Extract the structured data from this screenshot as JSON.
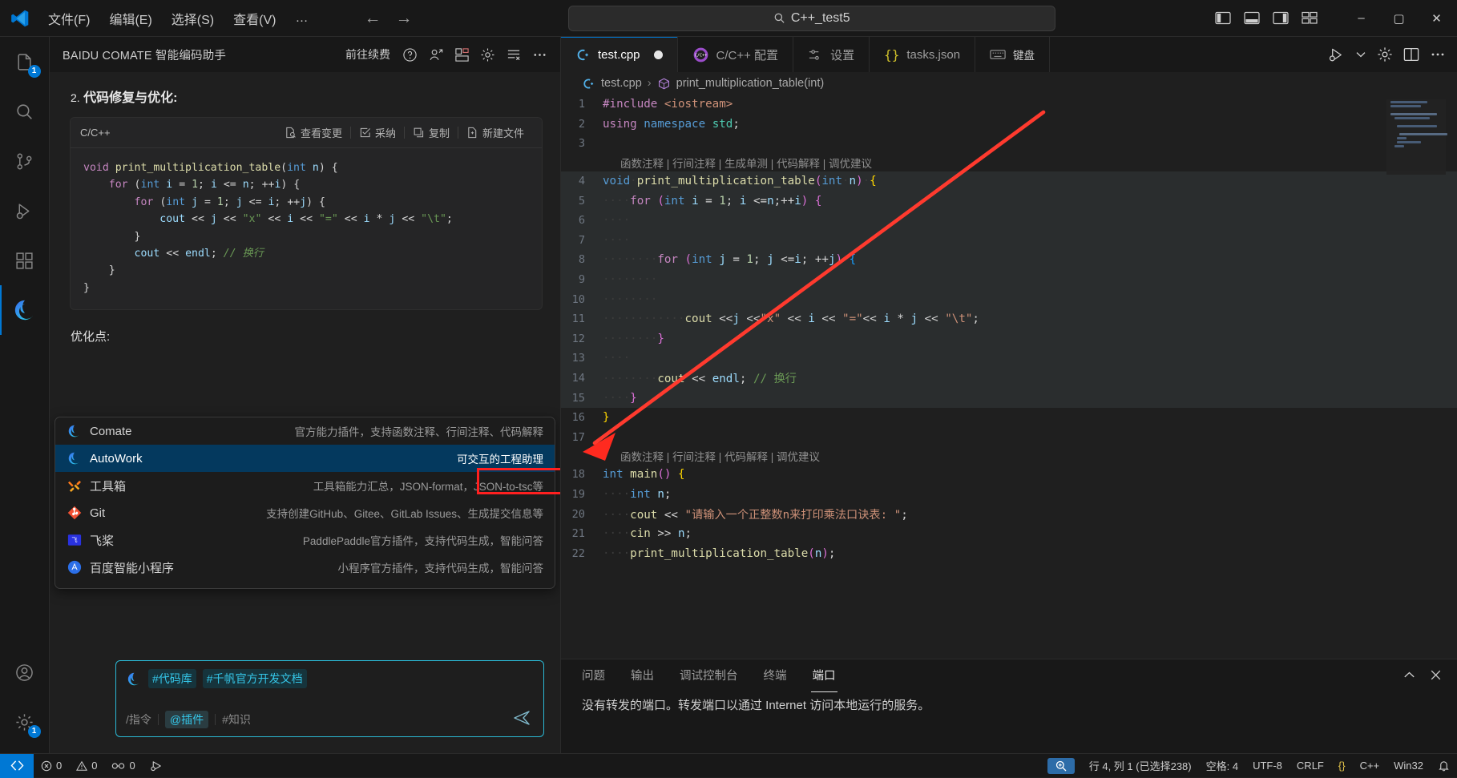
{
  "titlebar": {
    "logo_icon": "vscode-logo-icon",
    "menus": [
      "文件(F)",
      "编辑(E)",
      "选择(S)",
      "查看(V)",
      "…"
    ],
    "back_icon": "arrow-left-icon",
    "forward_icon": "arrow-right-icon",
    "search": {
      "icon": "search-icon",
      "value": "C++_test5"
    },
    "layout_icons": [
      "toggle-primary-sidebar-icon",
      "toggle-panel-icon",
      "toggle-secondary-sidebar-icon",
      "customize-layout-icon"
    ],
    "window_controls": {
      "minimize": "–",
      "maximize": "▢",
      "close": "✕"
    }
  },
  "activitybar": {
    "items": [
      {
        "name": "explorer",
        "icon": "files-icon",
        "badge": "1",
        "active": false
      },
      {
        "name": "search",
        "icon": "search-icon",
        "badge": "",
        "active": false
      },
      {
        "name": "source-control",
        "icon": "source-control-icon",
        "badge": "",
        "active": false
      },
      {
        "name": "run-and-debug",
        "icon": "run-debug-icon",
        "badge": "",
        "active": false
      },
      {
        "name": "extensions",
        "icon": "extensions-icon",
        "badge": "",
        "active": false
      },
      {
        "name": "comate",
        "icon": "comate-icon",
        "badge": "",
        "active": true
      }
    ],
    "bottom_items": [
      {
        "name": "accounts",
        "icon": "account-icon",
        "badge": ""
      },
      {
        "name": "settings",
        "icon": "gear-icon",
        "badge": "1"
      }
    ]
  },
  "comate": {
    "title": "BAIDU COMATE 智能编码助手",
    "renew_label": "前往续费",
    "header_icons": [
      "help-circle-icon",
      "share-person-icon",
      "layout-grid-icon",
      "gear-icon",
      "history-list-icon",
      "more-ellipsis-icon"
    ],
    "section": {
      "num": "2.",
      "title": "代码修复与优化:"
    },
    "codecard": {
      "lang": "C/C++",
      "tools": [
        {
          "label": "查看变更",
          "icon": "diff-icon"
        },
        {
          "label": "采纳",
          "icon": "check-box-icon"
        },
        {
          "label": "复制",
          "icon": "copy-icon"
        },
        {
          "label": "新建文件",
          "icon": "new-file-icon"
        }
      ],
      "code_lines": [
        "void print_multiplication_table(int n) {",
        "    for (int i = 1; i <= n; ++i) {",
        "        for (int j = 1; j <= i; ++j) {",
        "            cout << j << \"x\" << i << \"=\" << i * j << \"\\t\";",
        "        }",
        "        cout << endl; // 换行",
        "    }",
        "}"
      ]
    },
    "optimize_label": "优化点:",
    "plugins": [
      {
        "name": "Comate",
        "desc": "官方能力插件，支持函数注释、行间注释、代码解释",
        "icon": "comate-icon",
        "selected": false
      },
      {
        "name": "AutoWork",
        "desc": "可交互的工程助理",
        "icon": "comate-icon",
        "selected": true
      },
      {
        "name": "工具箱",
        "desc": "工具箱能力汇总，JSON-format，JSON-to-tsc等",
        "icon": "toolbox-icon",
        "selected": false
      },
      {
        "name": "Git",
        "desc": "支持创建GitHub、Gitee、GitLab Issues、生成提交信息等",
        "icon": "git-icon",
        "selected": false
      },
      {
        "name": "飞桨",
        "desc": "PaddlePaddle官方插件，支持代码生成，智能问答",
        "icon": "paddle-icon",
        "selected": false
      },
      {
        "name": "百度智能小程序",
        "desc": "小程序官方插件，支持代码生成，智能问答",
        "icon": "baidu-miniprogram-icon",
        "selected": false
      }
    ],
    "chat": {
      "avatar_icon": "comate-icon",
      "tags": [
        "#代码库",
        "#千帆官方开发文档"
      ],
      "hints": [
        "/指令",
        "@插件",
        "#知识"
      ],
      "send_icon": "send-icon"
    }
  },
  "editor": {
    "tabs": [
      {
        "label": "test.cpp",
        "icon": "cpp-file-icon",
        "active": true,
        "dirty": true
      },
      {
        "label": "C/C++ 配置",
        "icon": "cpp-config-icon",
        "active": false,
        "dirty": false
      },
      {
        "label": "设置",
        "icon": "settings-sliders-icon",
        "active": false,
        "dirty": false
      },
      {
        "label": "tasks.json",
        "icon": "json-braces-icon",
        "active": false,
        "dirty": false
      },
      {
        "label": "键盘",
        "icon": "keyboard-icon",
        "active": false,
        "dirty": false
      }
    ],
    "tab_actions": [
      "run-debug-icon",
      "chevron-down-icon",
      "gear-icon",
      "split-editor-icon",
      "more-ellipsis-icon"
    ],
    "breadcrumb": {
      "file": "test.cpp",
      "symbol": "print_multiplication_table(int)",
      "file_icon": "cpp-file-icon",
      "symbol_icon": "symbol-method-icon",
      "separator": "›"
    },
    "codelens_1": "函数注释 | 行间注释 | 生成单测 | 代码解释 | 调优建议",
    "codelens_2": "函数注释 | 行间注释 | 代码解释 | 调优建议",
    "lines": [
      {
        "n": "1",
        "text": "#include <iostream>"
      },
      {
        "n": "2",
        "text": "using namespace std;"
      },
      {
        "n": "3",
        "text": ""
      },
      {
        "n": "4",
        "text": "void print_multiplication_table(int n) {"
      },
      {
        "n": "5",
        "text": "    for (int i = 1; i <=n;++i) {"
      },
      {
        "n": "6",
        "text": ""
      },
      {
        "n": "7",
        "text": ""
      },
      {
        "n": "8",
        "text": "        for (int j = 1; j <=i; ++j) {"
      },
      {
        "n": "9",
        "text": ""
      },
      {
        "n": "10",
        "text": ""
      },
      {
        "n": "11",
        "text": "            cout <<j <<\"x\" << i << \"=\"<< i * j << \"\\t\";"
      },
      {
        "n": "12",
        "text": "        }"
      },
      {
        "n": "13",
        "text": ""
      },
      {
        "n": "14",
        "text": "        cout << endl; // 换行"
      },
      {
        "n": "15",
        "text": "    }"
      },
      {
        "n": "16",
        "text": "}"
      },
      {
        "n": "17",
        "text": ""
      },
      {
        "n": "18",
        "text": "int main() {"
      },
      {
        "n": "19",
        "text": "    int n;"
      },
      {
        "n": "20",
        "text": "    cout << \"请输入一个正整数n来打印乘法口诀表: \";"
      },
      {
        "n": "21",
        "text": "    cin >> n;"
      },
      {
        "n": "22",
        "text": "    print_multiplication_table(n);"
      }
    ]
  },
  "panel": {
    "tabs": [
      "问题",
      "输出",
      "调试控制台",
      "终端",
      "端口"
    ],
    "active_tab": "端口",
    "actions": [
      "chevron-up-icon",
      "close-icon"
    ],
    "content": "没有转发的端口。转发端口以通过 Internet 访问本地运行的服务。"
  },
  "statusbar": {
    "remote_icon": "remote-window-icon",
    "left": [
      {
        "name": "errors",
        "icon": "error-icon",
        "label": "0"
      },
      {
        "name": "warnings",
        "icon": "warning-icon",
        "label": "0"
      },
      {
        "name": "ports",
        "icon": "ports-icon",
        "label": "0"
      },
      {
        "name": "run-task",
        "icon": "run-icon",
        "label": ""
      }
    ],
    "right": [
      {
        "name": "screencast",
        "icon": "zoom-icon",
        "label": ""
      },
      {
        "name": "cursor-position",
        "label": "行 4, 列 1 (已选择238)"
      },
      {
        "name": "indentation",
        "label": "空格: 4"
      },
      {
        "name": "encoding",
        "label": "UTF-8"
      },
      {
        "name": "eol",
        "label": "CRLF"
      },
      {
        "name": "format",
        "label": "{}"
      },
      {
        "name": "language-mode",
        "label": "C++"
      },
      {
        "name": "platform",
        "label": "Win32"
      },
      {
        "name": "bell",
        "icon": "bell-icon",
        "label": ""
      }
    ]
  },
  "colors": {
    "accent": "#0078d4",
    "selection": "#04395e",
    "highlight_box": "#ff2020",
    "arrow": "#ff3b30",
    "chat_border": "#2bb8d4"
  }
}
